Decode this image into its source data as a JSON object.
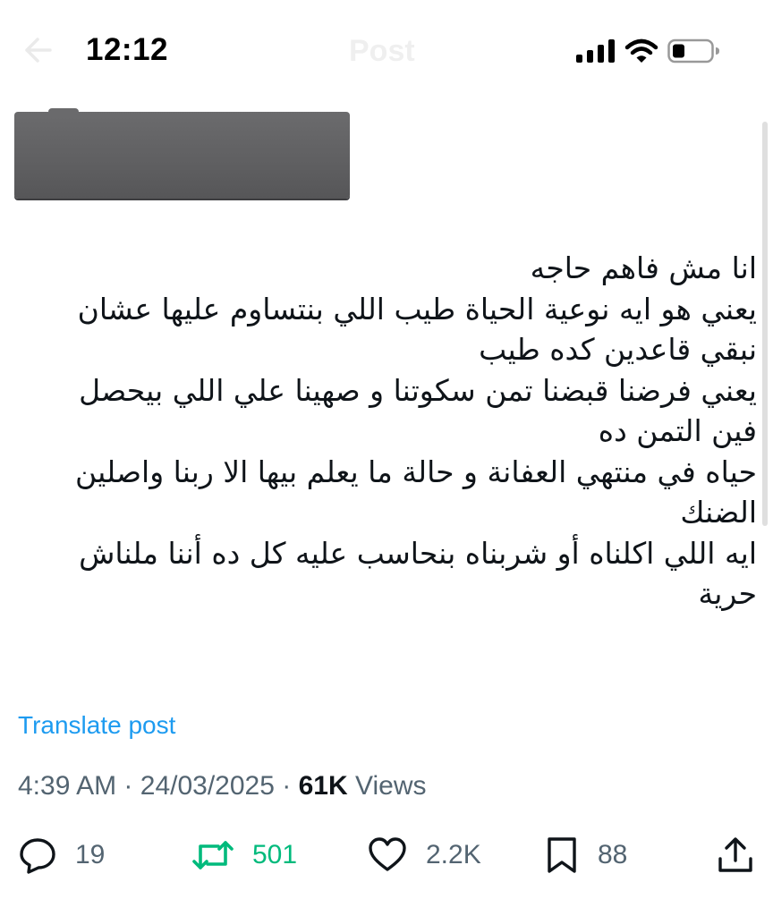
{
  "status_bar": {
    "time": "12:12"
  },
  "nav": {
    "title": "Post"
  },
  "tweet": {
    "lines": [
      "انا مش فاهم حاجه",
      "يعني هو ايه نوعية الحياة طيب اللي بنتساوم عليها عشان",
      "نبقي قاعدين كده طيب",
      "يعني فرضنا قبضنا تمن سكوتنا و صهينا علي اللي بيحصل",
      "فين التمن ده",
      "حياه في منتهي العفانة و حالة ما يعلم بيها الا ربنا واصلين",
      "الضنك",
      "ايه اللي اكلناه أو شربناه بنحاسب عليه كل ده أننا ملناش",
      "حرية"
    ]
  },
  "translate_label": "Translate post",
  "meta": {
    "time": "4:39 AM",
    "separator": "·",
    "date": "24/03/2025",
    "views_count": "61K",
    "views_label": "Views"
  },
  "actions": {
    "replies": "19",
    "reposts": "501",
    "likes": "2.2K",
    "bookmarks": "88"
  },
  "colors": {
    "accent_link": "#1d9bf0",
    "repost_active": "#00ba7c",
    "secondary_text": "#536471"
  },
  "icons": {
    "reply": "reply-bubble-icon",
    "repost": "repost-arrows-icon",
    "like": "heart-icon",
    "bookmark": "bookmark-icon",
    "share": "share-upload-icon"
  }
}
